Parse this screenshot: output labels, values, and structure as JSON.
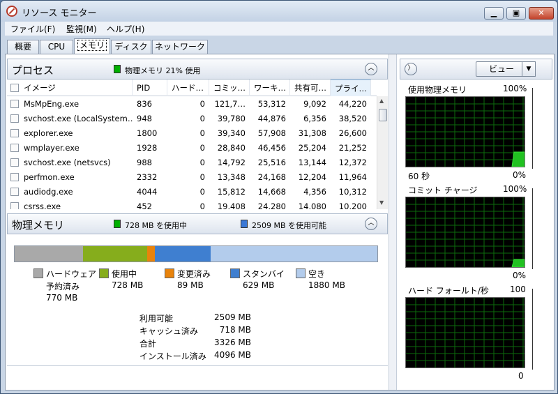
{
  "window": {
    "title": "リソース モニター"
  },
  "menu": [
    "ファイル(F)",
    "監視(M)",
    "ヘルプ(H)"
  ],
  "tabs": [
    "概要",
    "CPU",
    "メモリ",
    "ディスク",
    "ネットワーク"
  ],
  "active_tab": "メモリ",
  "process_panel": {
    "title": "プロセス",
    "summary": "物理メモリ 21% 使用",
    "columns": [
      "イメージ",
      "PID",
      "ハード…",
      "コミッ…",
      "ワーキ…",
      "共有可…",
      "プライ…"
    ],
    "rows": [
      [
        "MsMpEng.exe",
        "836",
        "0",
        "121,7…",
        "53,312",
        "9,092",
        "44,220"
      ],
      [
        "svchost.exe (LocalSystem…",
        "948",
        "0",
        "39,780",
        "44,876",
        "6,356",
        "38,520"
      ],
      [
        "explorer.exe",
        "1800",
        "0",
        "39,340",
        "57,908",
        "31,308",
        "26,600"
      ],
      [
        "wmplayer.exe",
        "1928",
        "0",
        "28,840",
        "46,456",
        "25,204",
        "21,252"
      ],
      [
        "svchost.exe (netsvcs)",
        "988",
        "0",
        "14,792",
        "25,516",
        "13,144",
        "12,372"
      ],
      [
        "perfmon.exe",
        "2332",
        "0",
        "13,348",
        "24,168",
        "12,204",
        "11,964"
      ],
      [
        "audiodg.exe",
        "4044",
        "0",
        "15,812",
        "14,668",
        "4,356",
        "10,312"
      ],
      [
        "csrss.exe",
        "452",
        "0",
        "19,408",
        "24,280",
        "14,080",
        "10,200"
      ]
    ]
  },
  "memory_panel": {
    "title": "物理メモリ",
    "in_use_summary": "728 MB を使用中",
    "available_summary": "2509 MB を使用可能",
    "bar_mb": {
      "hardware_reserved": 770,
      "in_use": 728,
      "modified": 89,
      "standby": 629,
      "free": 1880
    },
    "colors": {
      "hardware_reserved": "#a9a9a9",
      "in_use": "#86ad1c",
      "modified": "#e8830c",
      "standby": "#3f7fd0",
      "free": "#b3ccec"
    },
    "legend": [
      {
        "label": "ハードウェア",
        "sub": "予約済み",
        "value": "770 MB"
      },
      {
        "label": "使用中",
        "value": "728 MB"
      },
      {
        "label": "変更済み",
        "value": "89 MB"
      },
      {
        "label": "スタンバイ",
        "value": "629 MB"
      },
      {
        "label": "空き",
        "value": "1880 MB"
      }
    ],
    "stats": [
      {
        "label": "利用可能",
        "value": "2509 MB"
      },
      {
        "label": "キャッシュ済み",
        "value": "718 MB"
      },
      {
        "label": "合計",
        "value": "3326 MB"
      },
      {
        "label": "インストール済み",
        "value": "4096 MB"
      }
    ]
  },
  "right_pane": {
    "view_button": "ビュー",
    "graphs": [
      {
        "title": "使用物理メモリ",
        "max": "100%",
        "left_foot": "60 秒",
        "right_foot": "0%",
        "level_percent": 21
      },
      {
        "title": "コミット チャージ",
        "max": "100%",
        "left_foot": "",
        "right_foot": "0%",
        "level_percent": 11
      },
      {
        "title": "ハード フォールト/秒",
        "max": "100",
        "left_foot": "",
        "right_foot": "0",
        "level_percent": 0
      }
    ]
  }
}
